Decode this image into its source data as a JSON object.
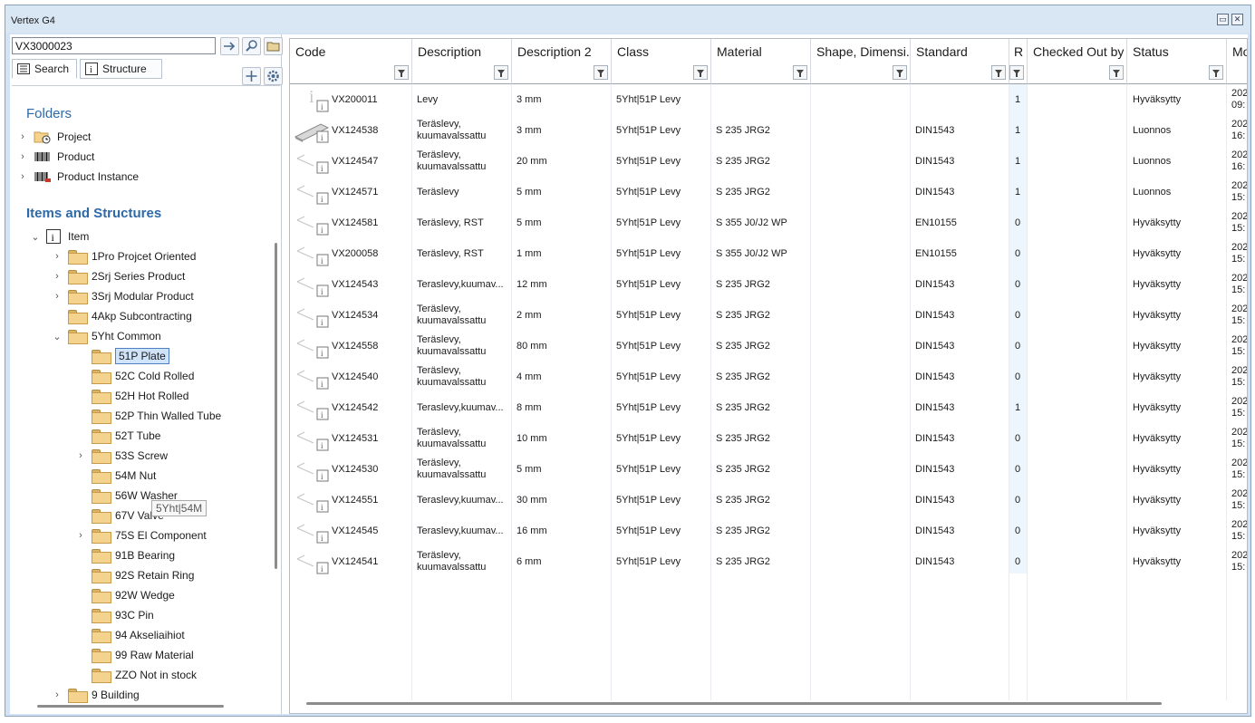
{
  "window": {
    "title": "Vertex G4"
  },
  "search": {
    "value": "VX3000023"
  },
  "tabs": {
    "search": "Search",
    "structure": "Structure"
  },
  "folders": {
    "heading": "Folders",
    "items": [
      {
        "label": "Project"
      },
      {
        "label": "Product"
      },
      {
        "label": "Product Instance"
      }
    ]
  },
  "items_section": {
    "heading": "Items and Structures"
  },
  "tree": {
    "root": "Item",
    "nodes": [
      {
        "label": "1Pro Projcet Oriented"
      },
      {
        "label": "2Srj Series Product"
      },
      {
        "label": "3Srj Modular Product"
      },
      {
        "label": "4Akp Subcontracting"
      },
      {
        "label": "5Yht Common"
      },
      {
        "label": "51P Plate"
      },
      {
        "label": "52C Cold Rolled"
      },
      {
        "label": "52H Hot Rolled"
      },
      {
        "label": "52P Thin Walled Tube"
      },
      {
        "label": "52T Tube"
      },
      {
        "label": "53S Screw"
      },
      {
        "label": "54M Nut"
      },
      {
        "label": "56W Washer"
      },
      {
        "label": "67V Valve"
      },
      {
        "label": "75S El Component"
      },
      {
        "label": "91B Bearing"
      },
      {
        "label": "92S Retain Ring"
      },
      {
        "label": "92W Wedge"
      },
      {
        "label": "93C Pin"
      },
      {
        "label": "94 Akseliaihiot"
      },
      {
        "label": "99 Raw Material"
      },
      {
        "label": "ZZO Not in stock"
      },
      {
        "label": "9 Building"
      }
    ],
    "tooltip": "5Yht|54M"
  },
  "grid": {
    "columns": [
      {
        "label": "Code"
      },
      {
        "label": "Description"
      },
      {
        "label": "Description 2"
      },
      {
        "label": "Class"
      },
      {
        "label": "Material"
      },
      {
        "label": "Shape, Dimensi..."
      },
      {
        "label": "Standard"
      },
      {
        "label": "R"
      },
      {
        "label": "Checked Out by"
      },
      {
        "label": "Status"
      },
      {
        "label": "Mo"
      }
    ],
    "rows": [
      {
        "code": "VX200011",
        "desc": "Levy",
        "desc2": "3 mm",
        "class": "5Yht|51P Levy",
        "material": "",
        "shape": "",
        "standard": "",
        "r": "1",
        "checked": "",
        "status": "Hyväksytty",
        "mod1": "202",
        "mod2": "09:"
      },
      {
        "code": "VX124538",
        "desc": "Teräslevy, kuumavalssattu",
        "desc2": "3 mm",
        "class": "5Yht|51P Levy",
        "material": "S 235 JRG2",
        "shape": "",
        "standard": "DIN1543",
        "r": "1",
        "checked": "",
        "status": "Luonnos",
        "mod1": "202",
        "mod2": "16:"
      },
      {
        "code": "VX124547",
        "desc": "Teräslevy, kuumavalssattu",
        "desc2": "20 mm",
        "class": "5Yht|51P Levy",
        "material": "S 235 JRG2",
        "shape": "",
        "standard": "DIN1543",
        "r": "1",
        "checked": "",
        "status": "Luonnos",
        "mod1": "202",
        "mod2": "16:"
      },
      {
        "code": "VX124571",
        "desc": "Teräslevy",
        "desc2": "5 mm",
        "class": "5Yht|51P Levy",
        "material": "S 235 JRG2",
        "shape": "",
        "standard": "DIN1543",
        "r": "1",
        "checked": "",
        "status": "Luonnos",
        "mod1": "202",
        "mod2": "15:"
      },
      {
        "code": "VX124581",
        "desc": "Teräslevy, RST",
        "desc2": "5 mm",
        "class": "5Yht|51P Levy",
        "material": "S 355 J0/J2 WP",
        "shape": "",
        "standard": "EN10155",
        "r": "0",
        "checked": "",
        "status": "Hyväksytty",
        "mod1": "202",
        "mod2": "15:"
      },
      {
        "code": "VX200058",
        "desc": "Teräslevy, RST",
        "desc2": "1 mm",
        "class": "5Yht|51P Levy",
        "material": "S 355 J0/J2 WP",
        "shape": "",
        "standard": "EN10155",
        "r": "0",
        "checked": "",
        "status": "Hyväksytty",
        "mod1": "202",
        "mod2": "15:"
      },
      {
        "code": "VX124543",
        "desc": "Teraslevy,kuumav...",
        "desc2": "12  mm",
        "class": "5Yht|51P Levy",
        "material": "S 235 JRG2",
        "shape": "",
        "standard": "DIN1543",
        "r": "0",
        "checked": "",
        "status": "Hyväksytty",
        "mod1": "202",
        "mod2": "15:"
      },
      {
        "code": "VX124534",
        "desc": "Teräslevy, kuumavalssattu",
        "desc2": "2 mm",
        "class": "5Yht|51P Levy",
        "material": "S 235 JRG2",
        "shape": "",
        "standard": "DIN1543",
        "r": "0",
        "checked": "",
        "status": "Hyväksytty",
        "mod1": "202",
        "mod2": "15:"
      },
      {
        "code": "VX124558",
        "desc": "Teräslevy, kuumavalssattu",
        "desc2": "80 mm",
        "class": "5Yht|51P Levy",
        "material": "S 235 JRG2",
        "shape": "",
        "standard": "DIN1543",
        "r": "0",
        "checked": "",
        "status": "Hyväksytty",
        "mod1": "202",
        "mod2": "15:"
      },
      {
        "code": "VX124540",
        "desc": "Teräslevy, kuumavalssattu",
        "desc2": "4 mm",
        "class": "5Yht|51P Levy",
        "material": "S 235 JRG2",
        "shape": "",
        "standard": "DIN1543",
        "r": "0",
        "checked": "",
        "status": "Hyväksytty",
        "mod1": "202",
        "mod2": "15:"
      },
      {
        "code": "VX124542",
        "desc": "Teraslevy,kuumav...",
        "desc2": "8 mm",
        "class": "5Yht|51P Levy",
        "material": "S 235 JRG2",
        "shape": "",
        "standard": "DIN1543",
        "r": "1",
        "checked": "",
        "status": "Hyväksytty",
        "mod1": "202",
        "mod2": "15:"
      },
      {
        "code": "VX124531",
        "desc": "Teräslevy, kuumavalssattu",
        "desc2": "10 mm",
        "class": "5Yht|51P Levy",
        "material": "S 235 JRG2",
        "shape": "",
        "standard": "DIN1543",
        "r": "0",
        "checked": "",
        "status": "Hyväksytty",
        "mod1": "202",
        "mod2": "15:"
      },
      {
        "code": "VX124530",
        "desc": "Teräslevy, kuumavalssattu",
        "desc2": "5 mm",
        "class": "5Yht|51P Levy",
        "material": "S 235 JRG2",
        "shape": "",
        "standard": "DIN1543",
        "r": "0",
        "checked": "",
        "status": "Hyväksytty",
        "mod1": "202",
        "mod2": "15:"
      },
      {
        "code": "VX124551",
        "desc": "Teraslevy,kuumav...",
        "desc2": "30 mm",
        "class": "5Yht|51P Levy",
        "material": "S 235 JRG2",
        "shape": "",
        "standard": "DIN1543",
        "r": "0",
        "checked": "",
        "status": "Hyväksytty",
        "mod1": "202",
        "mod2": "15:"
      },
      {
        "code": "VX124545",
        "desc": "Teraslevy,kuumav...",
        "desc2": "16 mm",
        "class": "5Yht|51P Levy",
        "material": "S 235 JRG2",
        "shape": "",
        "standard": "DIN1543",
        "r": "0",
        "checked": "",
        "status": "Hyväksytty",
        "mod1": "202",
        "mod2": "15:"
      },
      {
        "code": "VX124541",
        "desc": "Teräslevy, kuumavalssattu",
        "desc2": "6  mm",
        "class": "5Yht|51P Levy",
        "material": "S 235 JRG2",
        "shape": "",
        "standard": "DIN1543",
        "r": "0",
        "checked": "",
        "status": "Hyväksytty",
        "mod1": "202",
        "mod2": "15:"
      }
    ]
  },
  "icons": {
    "go": "arrow-right-icon",
    "find": "magnifier-icon",
    "browse": "folder-open-icon",
    "add": "plus-icon",
    "settings": "gear-icon"
  },
  "colors": {
    "heading": "#2e69a8",
    "selection": "#cfe3fa",
    "r_column": "#eef6fd"
  }
}
